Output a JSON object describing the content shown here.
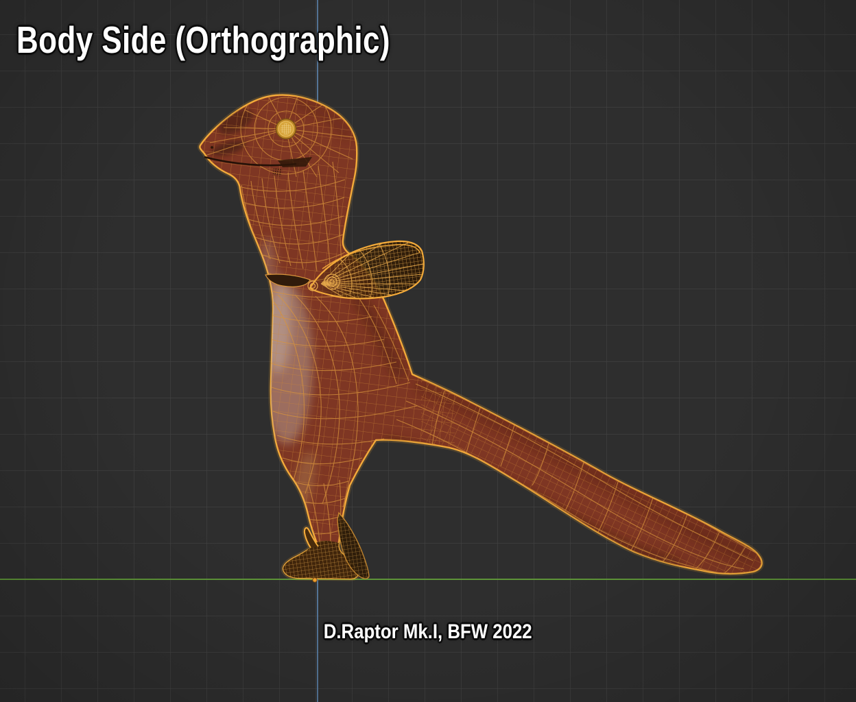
{
  "overlay": {
    "title": "Body Side (Orthographic)",
    "caption": "D.Raptor Mk.I, BFW 2022"
  },
  "scene": {
    "colors": {
      "background": "#2e2e2e",
      "grid_line": "#434343",
      "axis_vertical_blue": "#5e86b0",
      "axis_ground_green": "#609a38",
      "body_fill": "#7e3623",
      "wire_orange": "#d8943c",
      "selection_outline": "#f4ab3a",
      "eye_gold": "#d8a53c",
      "arm_dark": "#3a2106",
      "belly_highlight": "#b49c92"
    },
    "grid": {
      "spacing_px": 53
    }
  }
}
